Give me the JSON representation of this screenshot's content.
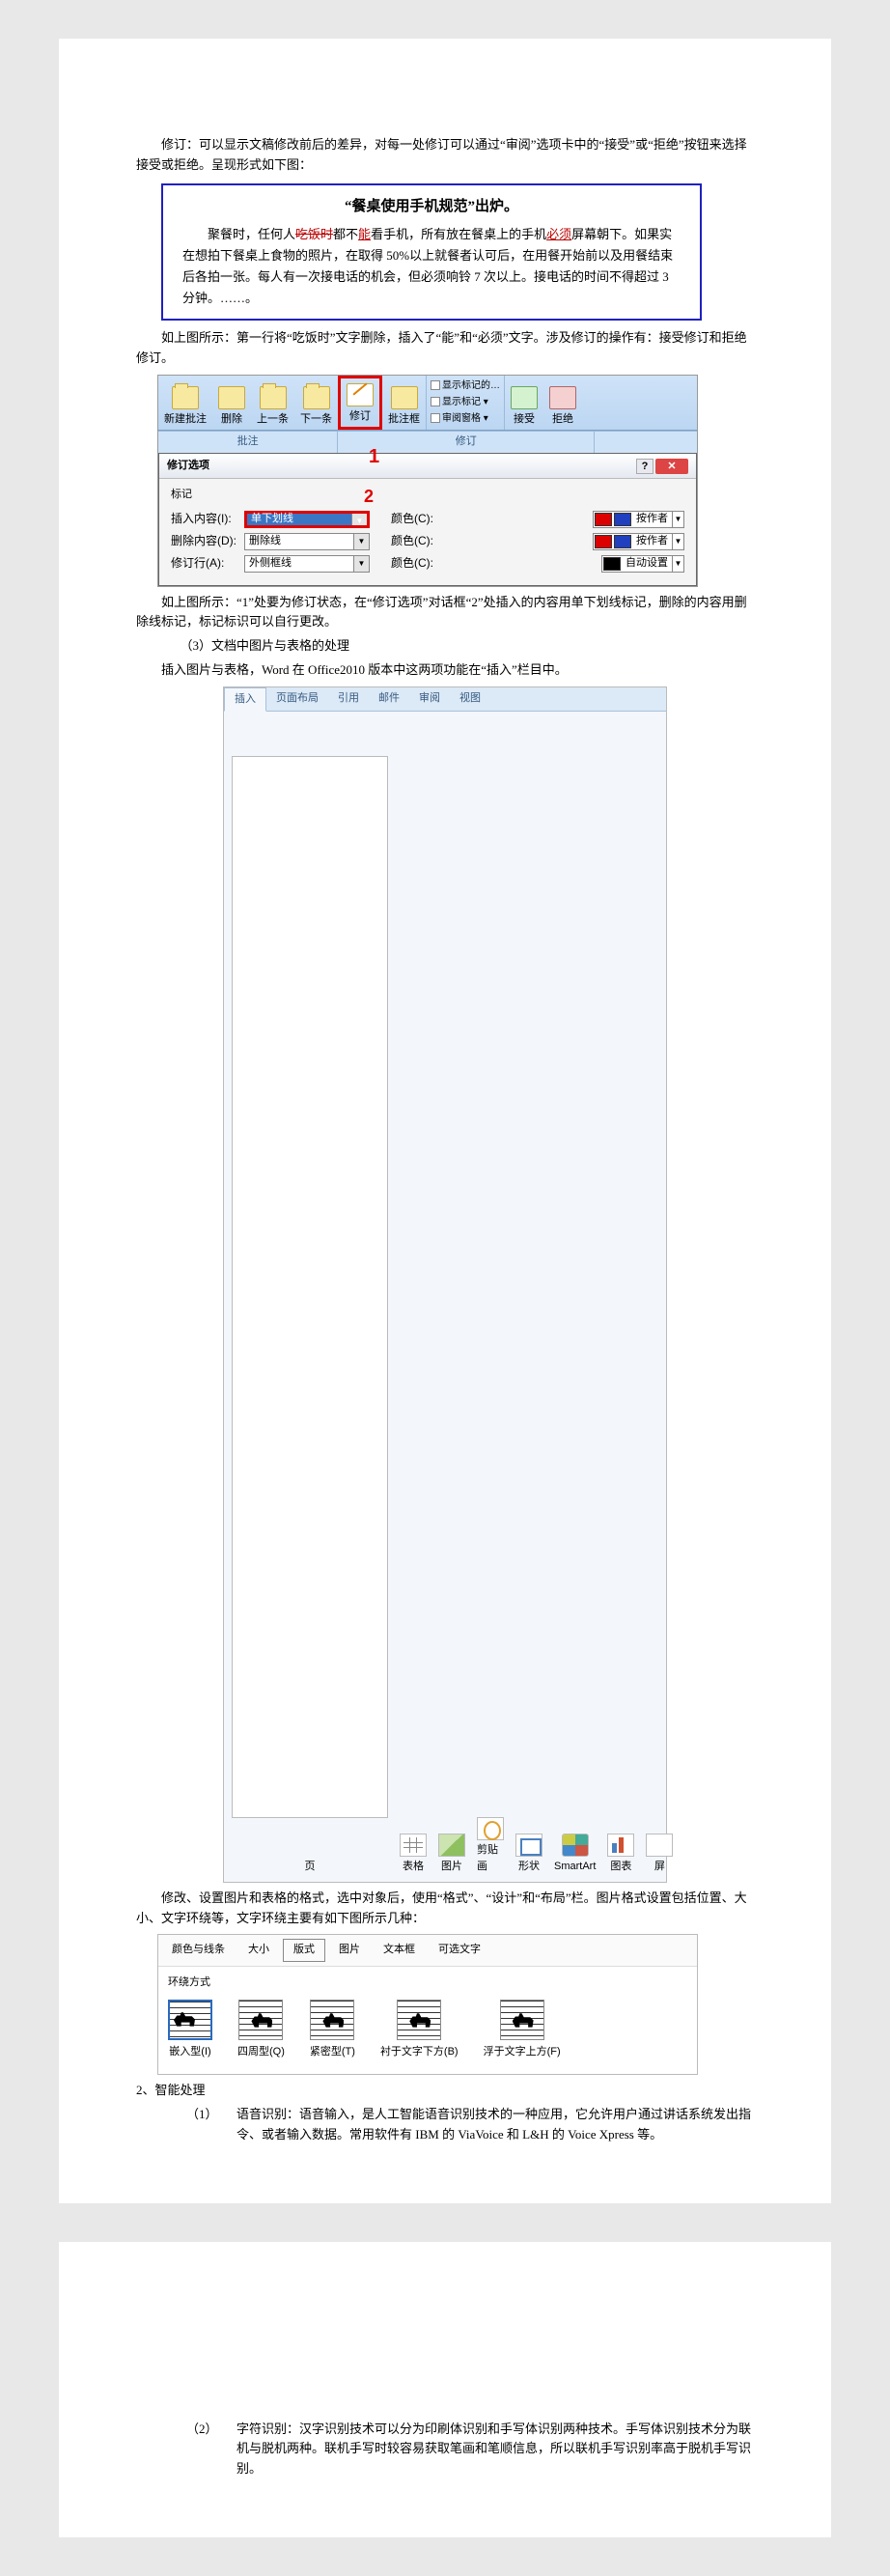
{
  "para_intro": "修订：可以显示文稿修改前后的差异，对每一处修订可以通过“审阅”选项卡中的“接受”或“拒绝”按钮来选择接受或拒绝。呈现形式如下图：",
  "example": {
    "title": "“餐桌使用手机规范”出炉。",
    "seg1": "聚餐时，任何人",
    "strike": "吃饭时",
    "seg2": "都不",
    "ins1": "能",
    "seg3": "看手机，所有放在餐桌上的手机",
    "ins2": "必须",
    "seg4": "屏幕朝下。如果实在想拍下餐桌上食物的照片，在取得 50%以上就餐者认可后，在用餐开始前以及用餐结束后各拍一张。每人有一次接电话的机会，但必须响铃 7 次以上。接电话的时间不得超过 3 分钟。……。"
  },
  "para_after_example": "如上图所示：第一行将“吃饭时”文字删除，插入了“能”和“必须”文字。涉及修订的操作有：接受修订和拒绝修订。",
  "ribbon": {
    "new_comment": "新建批注",
    "delete": "删除",
    "prev": "上一条",
    "next": "下一条",
    "track": "修订",
    "balloons": "批注框",
    "show_markup": "显示标记的…",
    "show_marks": "显示标记 ▾",
    "review_pane": "审阅窗格 ▾",
    "accept": "接受",
    "reject": "拒绝",
    "group_comments": "批注",
    "group_tracking": "修订",
    "num1": "1"
  },
  "dialog": {
    "title": "修订选项",
    "section": "标记",
    "num2": "2",
    "row_insert_lbl": "插入内容(I):",
    "row_insert_val": "单下划线",
    "row_delete_lbl": "删除内容(D):",
    "row_delete_val": "删除线",
    "row_line_lbl": "修订行(A):",
    "row_line_val": "外侧框线",
    "color_lbl": "颜色(C):",
    "by_author": "按作者",
    "auto": "自动设置"
  },
  "para_after_dialog": "如上图所示：“1”处要为修订状态，在“修订选项”对话框“2”处插入的内容用单下划线标记，删除的内容用删除线标记，标记标识可以自行更改。",
  "para_3": "（3）文档中图片与表格的处理",
  "para_insert_intro": "插入图片与表格，Word 在 Office2010 版本中这两项功能在“插入”栏目中。",
  "insert_tabs": {
    "insert": "插入",
    "layout": "页面布局",
    "ref": "引用",
    "mail": "邮件",
    "review": "审阅",
    "view": "视图"
  },
  "insert_btns": {
    "page": "页",
    "table": "表格",
    "picture": "图片",
    "clipart": "剪贴画",
    "shapes": "形状",
    "smartart": "SmartArt",
    "chart": "图表",
    "screen": "屏"
  },
  "para_wrap_intro": "修改、设置图片和表格的格式，选中对象后，使用“格式”、“设计”和“布局”栏。图片格式设置包括位置、大小、文字环绕等，文字环绕主要有如下图所示几种：",
  "wrap": {
    "tab_colors": "颜色与线条",
    "tab_size": "大小",
    "tab_layout": "版式",
    "tab_picture": "图片",
    "tab_textbox": "文本框",
    "tab_alt": "可选文字",
    "section": "环绕方式",
    "opt_inline": "嵌入型(I)",
    "opt_square": "四周型(Q)",
    "opt_tight": "紧密型(T)",
    "opt_behind": "衬于文字下方(B)",
    "opt_front": "浮于文字上方(F)"
  },
  "heading_smart": "2、智能处理",
  "item1_no": "（1）",
  "item1_body": "语音识别：语音输入，是人工智能语音识别技术的一种应用，它允许用户通过讲话系统发出指令、或者输入数据。常用软件有 IBM 的 ViaVoice 和 L&H 的 Voice Xpress 等。",
  "item2_no": "（2）",
  "item2_body": "字符识别：汉字识别技术可以分为印刷体识别和手写体识别两种技术。手写体识别技术分为联机与脱机两种。联机手写时较容易获取笔画和笔顺信息，所以联机手写识别率高于脱机手写识别。"
}
